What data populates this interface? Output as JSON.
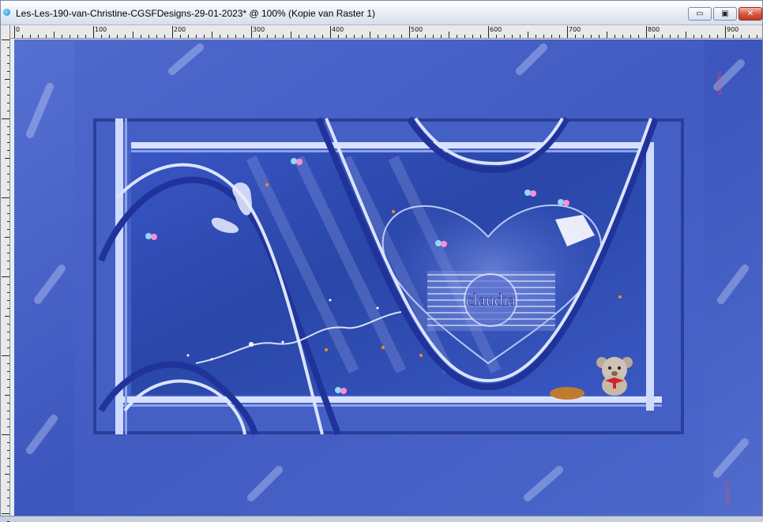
{
  "window": {
    "title": "Les-Les-190-van-Christine-CGSFDesigns-29-01-2023* @ 100% (Kopie van Raster 1)",
    "buttons": {
      "minimize": "▭",
      "maximize": "▣",
      "close": "✕"
    }
  },
  "ruler": {
    "labels": [
      "0",
      "100",
      "200",
      "300",
      "400",
      "500",
      "600",
      "700",
      "800",
      "900"
    ]
  },
  "artwork": {
    "watermark": "claudia",
    "colors": {
      "background": "#3f5ac0",
      "frame": "#2c3f9e",
      "highlight": "#d8e2ff"
    }
  }
}
